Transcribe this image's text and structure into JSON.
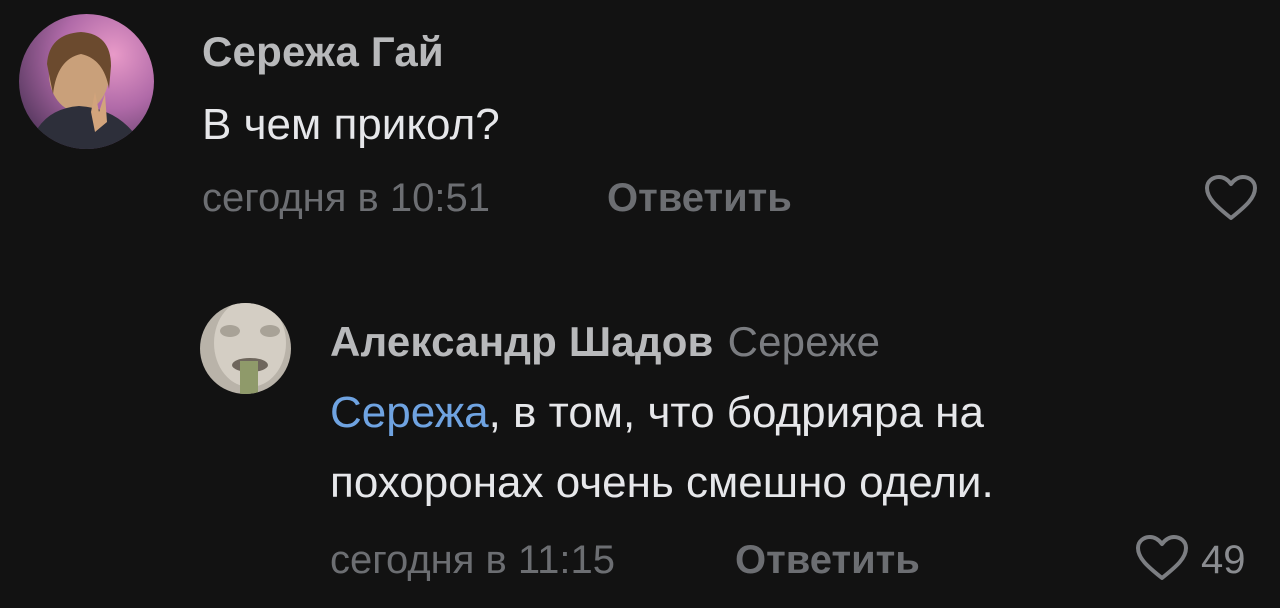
{
  "comments": [
    {
      "author": "Сережа Гай",
      "text": "В чем прикол?",
      "time": "сегодня в 10:51",
      "reply_label": "Ответить",
      "likes": ""
    },
    {
      "author": "Александр Шадов",
      "reply_to": "Сереже",
      "mention": "Сережа",
      "text_line1": ", в том, что бодрияра на",
      "text_line2": "похоронах очень смешно одели.",
      "time": "сегодня в 11:15",
      "reply_label": "Ответить",
      "likes": "49"
    }
  ],
  "colors": {
    "background": "#121212",
    "mention": "#6fa3e1",
    "muted": "#6c6e72"
  },
  "icons": {
    "like": "heart-outline-icon"
  }
}
